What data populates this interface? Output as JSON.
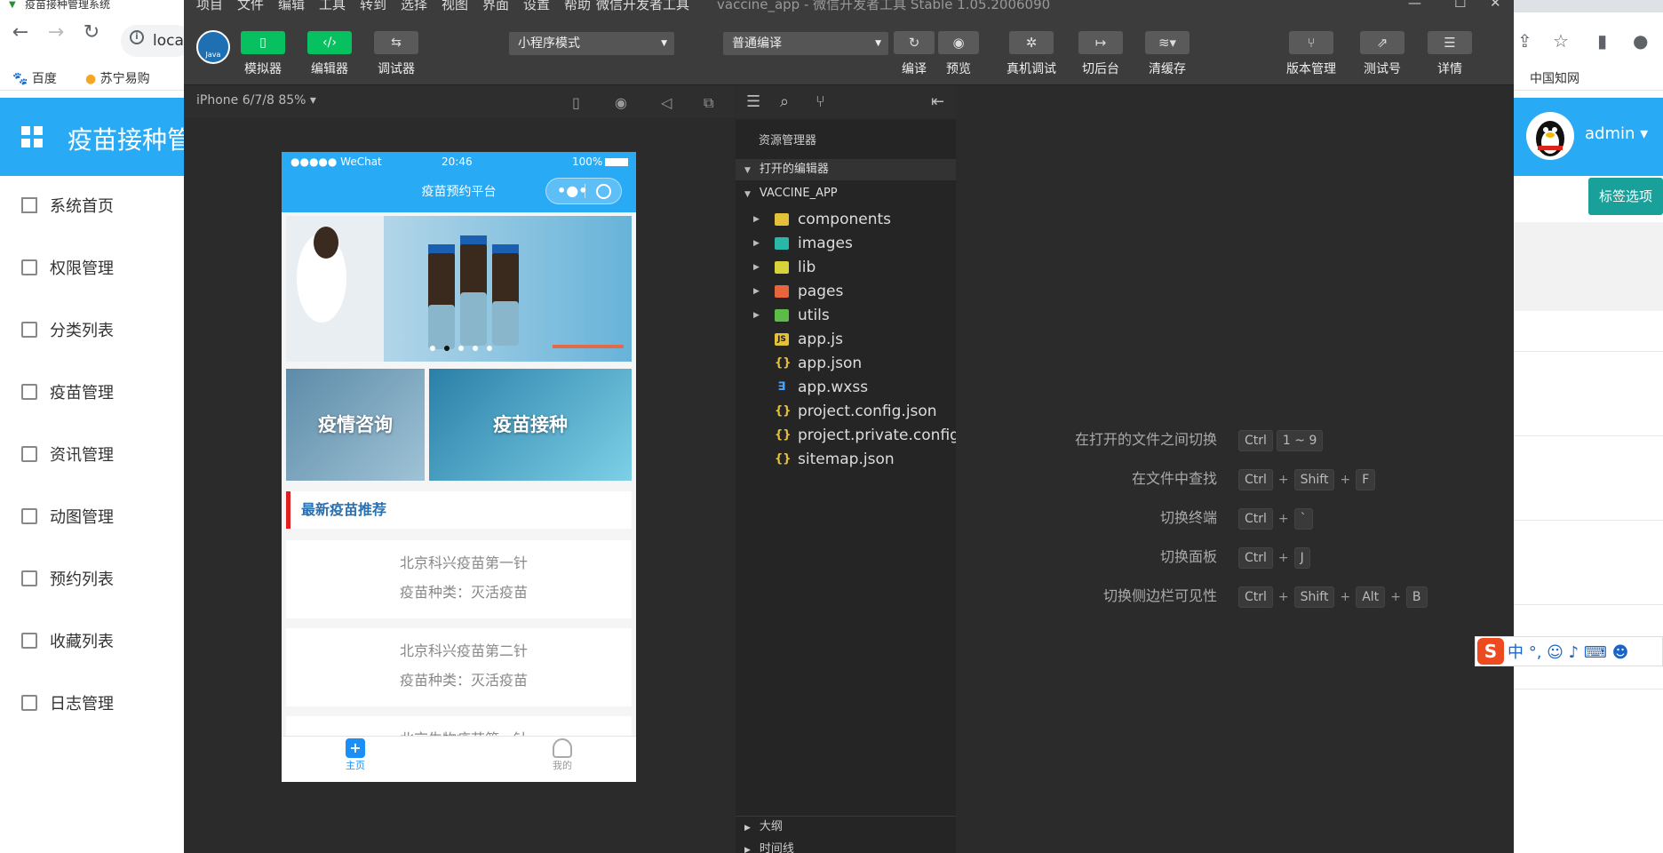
{
  "browser": {
    "tab_title": "疫苗接种管理系统",
    "url_text": "loca",
    "bookmarks": [
      "百度",
      "苏宁易购",
      "中国知网"
    ]
  },
  "admin": {
    "title": "疫苗接种管",
    "user": "admin",
    "tag_button": "标签选项",
    "sidebar": [
      "系统首页",
      "权限管理",
      "分类列表",
      "疫苗管理",
      "资讯管理",
      "动图管理",
      "预约列表",
      "收藏列表",
      "日志管理"
    ]
  },
  "devtools": {
    "menus": [
      "项目",
      "文件",
      "编辑",
      "工具",
      "转到",
      "选择",
      "视图",
      "界面",
      "设置",
      "帮助",
      "微信开发者工具"
    ],
    "window_title": "vaccine_app - 微信开发者工具 Stable 1.05.2006090",
    "toolbar": {
      "simulator": "模拟器",
      "editor": "编辑器",
      "debugger": "调试器",
      "mode_select": "小程序模式",
      "compile_select": "普通编译",
      "compile": "编译",
      "preview": "预览",
      "real_debug": "真机调试",
      "background": "切后台",
      "clear_cache": "清缓存",
      "version": "版本管理",
      "test_id": "测试号",
      "details": "详情"
    },
    "device": "iPhone 6/7/8 85%",
    "explorer": {
      "title": "资源管理器",
      "open_editors": "打开的编辑器",
      "project": "VACCINE_APP",
      "folders": [
        "components",
        "images",
        "lib",
        "pages",
        "utils"
      ],
      "files": [
        "app.js",
        "app.json",
        "app.wxss",
        "project.config.json",
        "project.private.config...",
        "sitemap.json"
      ],
      "outline": "大纲",
      "timeline": "时间线"
    },
    "shortcuts": [
      {
        "desc": "在打开的文件之间切换",
        "keys": [
          "Ctrl",
          "1 ~ 9"
        ]
      },
      {
        "desc": "在文件中查找",
        "keys": [
          "Ctrl",
          "Shift",
          "F"
        ]
      },
      {
        "desc": "切换终端",
        "keys": [
          "Ctrl",
          "`"
        ]
      },
      {
        "desc": "切换面板",
        "keys": [
          "Ctrl",
          "J"
        ]
      },
      {
        "desc": "切换侧边栏可见性",
        "keys": [
          "Ctrl",
          "Shift",
          "Alt",
          "B"
        ]
      }
    ]
  },
  "phone": {
    "carrier": "●●●●● WeChat",
    "time": "20:46",
    "battery": "100%",
    "nav_title": "疫苗预约平台",
    "tile1": "疫情咨询",
    "tile2": "疫苗接种",
    "section": "最新疫苗推荐",
    "cards": [
      {
        "name": "北京科兴疫苗第一针",
        "type": "疫苗种类：灭活疫苗"
      },
      {
        "name": "北京科兴疫苗第二针",
        "type": "疫苗种类：灭活疫苗"
      },
      {
        "name": "北京生物疫苗第一针",
        "type": ""
      }
    ],
    "tab_home": "主页",
    "tab_mine": "我的"
  },
  "ime": {
    "brand": "S",
    "mode": "中"
  }
}
